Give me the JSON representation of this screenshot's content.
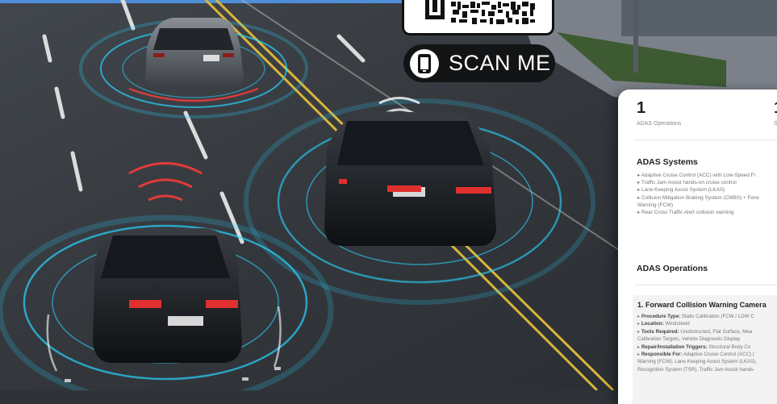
{
  "qr": {
    "label": "SCAN ME"
  },
  "panel": {
    "stat_1": {
      "value": "1",
      "label": "ADAS Operations"
    },
    "stat_2_partial": {
      "value": "1",
      "label": "S"
    },
    "systems_title": "ADAS Systems",
    "systems": [
      "▸ Adaptive Cruise Control (ACC) with Low-Speed Fi",
      "▸ Traffic Jam Assist hands-on cruise control",
      "▸ Lane Keeping Assist System (LKAS)",
      "▸ Collision Mitigation Braking System (CMBS) + Forw",
      "Warning (FCW)",
      "▸ Rear Cross Traffic Alert collision warning"
    ],
    "operations_title": "ADAS Operations",
    "operation": {
      "title": "1. Forward Collision Warning Camera",
      "lines": [
        {
          "label": "Procedure Type:",
          "text": " Static Calibration (FCW / LDW C"
        },
        {
          "label": "Location:",
          "text": " Windshield"
        },
        {
          "label": "Tools Required:",
          "text": " Unobstructed, Flat Surface, Mea"
        },
        {
          "label": "",
          "text": "Calibration Targets, Vehicle Diagnostic Display"
        },
        {
          "label": "Repair/Installation Triggers:",
          "text": " Structural Body Co"
        },
        {
          "label": "Responsible For:",
          "text": " Adaptive Cruise Control (ACC) ("
        },
        {
          "label": "",
          "text": "Warning (FCW), Lane Keeping Assist System (LKAS),"
        },
        {
          "label": "",
          "text": "Recognition System (TSR), Traffic Jam Assist hands-"
        }
      ]
    }
  }
}
